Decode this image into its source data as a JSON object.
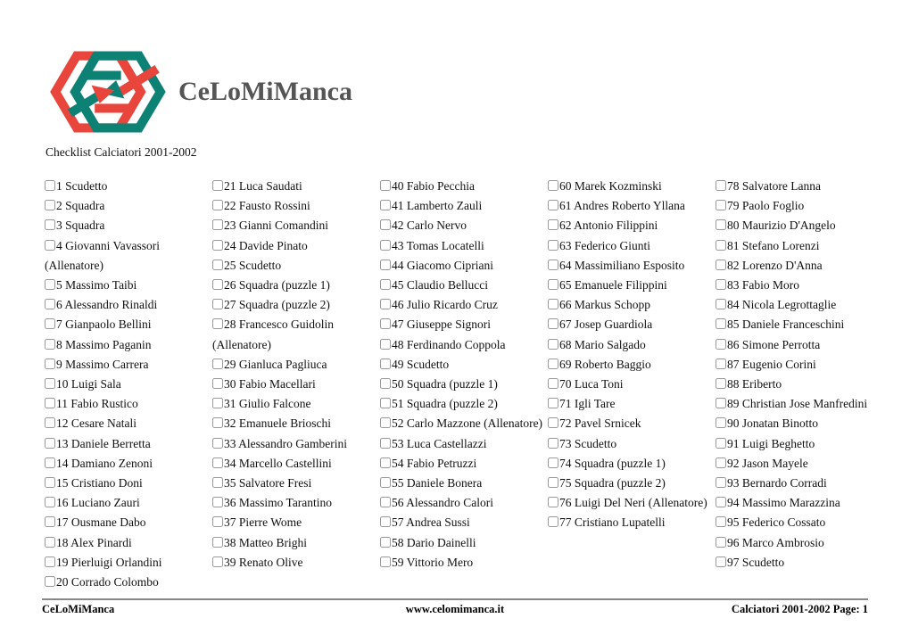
{
  "brand": {
    "title": "CeLoMiManca",
    "logo_icon": "hexagon-arrows-logo-icon",
    "colors": {
      "red": "#e8453c",
      "teal": "#0e8175",
      "title_gray": "#555555"
    }
  },
  "subtitle": "Checklist Calciatori 2001-2002",
  "columns": [
    {
      "items": [
        "1 Scudetto",
        "2 Squadra",
        "3 Squadra",
        "4 Giovanni Vavassori (Allenatore)",
        "5 Massimo Taibi",
        "6 Alessandro Rinaldi",
        "7 Gianpaolo Bellini",
        "8 Massimo Paganin",
        "9 Massimo Carrera",
        "10 Luigi Sala",
        "11 Fabio Rustico",
        "12 Cesare Natali",
        "13 Daniele Berretta",
        "14 Damiano Zenoni",
        "15 Cristiano Doni",
        "16 Luciano Zauri",
        "17 Ousmane Dabo",
        "18 Alex Pinardi",
        "19 Pierluigi Orlandini",
        "20 Corrado Colombo"
      ]
    },
    {
      "items": [
        "21 Luca Saudati",
        "22 Fausto Rossini",
        "23 Gianni Comandini",
        "24 Davide Pinato",
        "25 Scudetto",
        "26 Squadra (puzzle 1)",
        "27 Squadra (puzzle 2)",
        "28 Francesco Guidolin (Allenatore)",
        "29 Gianluca Pagliuca",
        "30 Fabio Macellari",
        "31 Giulio Falcone",
        "32 Emanuele Brioschi",
        "33 Alessandro Gamberini",
        "34 Marcello Castellini",
        "35 Salvatore Fresi",
        "36 Massimo Tarantino",
        "37 Pierre Wome",
        "38 Matteo Brighi",
        "39 Renato Olive"
      ]
    },
    {
      "items": [
        "40 Fabio Pecchia",
        "41 Lamberto Zauli",
        "42 Carlo Nervo",
        "43 Tomas Locatelli",
        "44 Giacomo Cipriani",
        "45 Claudio Bellucci",
        "46 Julio Ricardo Cruz",
        "47 Giuseppe Signori",
        "48 Ferdinando Coppola",
        "49 Scudetto",
        "50 Squadra (puzzle 1)",
        "51 Squadra (puzzle 2)",
        "52 Carlo Mazzone (Allenatore)",
        "53 Luca Castellazzi",
        "54 Fabio Petruzzi",
        "55 Daniele Bonera",
        "56 Alessandro Calori",
        "57 Andrea Sussi",
        "58 Dario Dainelli",
        "59 Vittorio Mero"
      ]
    },
    {
      "items": [
        "60 Marek Kozminski",
        "61 Andres Roberto Yllana",
        "62 Antonio Filippini",
        "63 Federico Giunti",
        "64 Massimiliano Esposito",
        "65 Emanuele Filippini",
        "66 Markus Schopp",
        "67 Josep Guardiola",
        "68 Mario Salgado",
        "69 Roberto Baggio",
        "70 Luca Toni",
        "71 Igli Tare",
        "72 Pavel Srnicek",
        "73 Scudetto",
        "74 Squadra (puzzle 1)",
        "75 Squadra (puzzle 2)",
        "76 Luigi Del Neri (Allenatore)",
        "77 Cristiano Lupatelli"
      ]
    },
    {
      "items": [
        "78 Salvatore Lanna",
        "79 Paolo Foglio",
        "80 Maurizio D'Angelo",
        "81 Stefano Lorenzi",
        "82 Lorenzo D'Anna",
        "83 Fabio Moro",
        "84 Nicola Legrottaglie",
        "85 Daniele Franceschini",
        "86 Simone Perrotta",
        "87 Eugenio Corini",
        "88 Eriberto",
        "89 Christian Jose Manfredini",
        "90 Jonatan Binotto",
        "91 Luigi Beghetto",
        "92 Jason Mayele",
        "93 Bernardo Corradi",
        "94 Massimo Marazzina",
        "95 Federico Cossato",
        "96 Marco Ambrosio",
        "97 Scudetto"
      ]
    }
  ],
  "footer": {
    "left": "CeLoMiManca",
    "center": "www.celomimanca.it",
    "right": "Calciatori 2001-2002 Page: 1"
  }
}
